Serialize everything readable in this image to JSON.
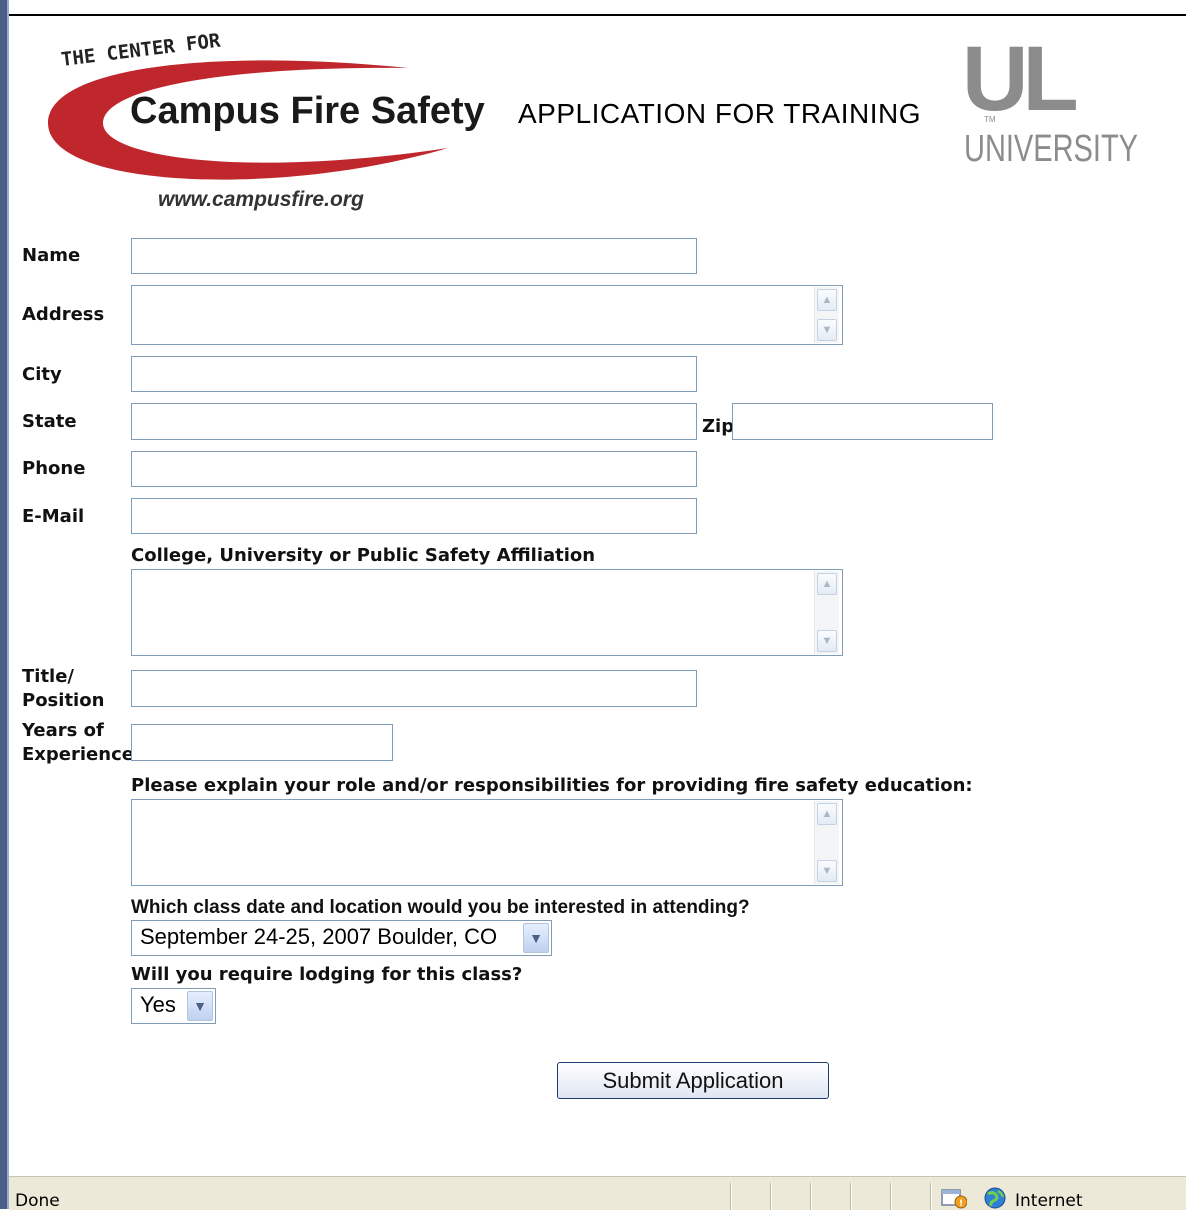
{
  "header": {
    "logo_top_text": "THE CENTER FOR",
    "logo_main_text": "Campus Fire Safety",
    "logo_url_text": "www.campusfire.org",
    "title": "APPLICATION FOR TRAINING",
    "ul_letters": "UL",
    "ul_tm": "TM",
    "ul_university": "UNIVERSITY"
  },
  "form": {
    "name_label": "Name",
    "name_value": "",
    "address_label": "Address",
    "address_value": "",
    "city_label": "City",
    "city_value": "",
    "state_label": "State",
    "state_value": "",
    "zip_label": "Zip",
    "zip_value": "",
    "phone_label": "Phone",
    "phone_value": "",
    "email_label": "E-Mail",
    "email_value": "",
    "affiliation_label": "College, University or Public Safety Affiliation",
    "affiliation_value": "",
    "title_label_line1": "Title/",
    "title_label_line2": "Position",
    "title_value": "",
    "years_label_line1": "Years of",
    "years_label_line2": "Experience",
    "years_value": "",
    "role_label": "Please explain your role and/or responsibilities for providing fire safety education:",
    "role_value": "",
    "class_label": "Which class date and location would you be interested in attending?",
    "class_selected": "September 24-25, 2007 Boulder, CO",
    "lodging_label": "Will you require lodging for this class?",
    "lodging_selected": "Yes",
    "submit_label": "Submit Application"
  },
  "statusbar": {
    "status": "Done",
    "zone": "Internet"
  },
  "colors": {
    "logo_red": "#c0272d",
    "ul_gray": "#8c8c8c",
    "input_border": "#7f9db9",
    "statusbar_bg": "#ece9d8"
  }
}
